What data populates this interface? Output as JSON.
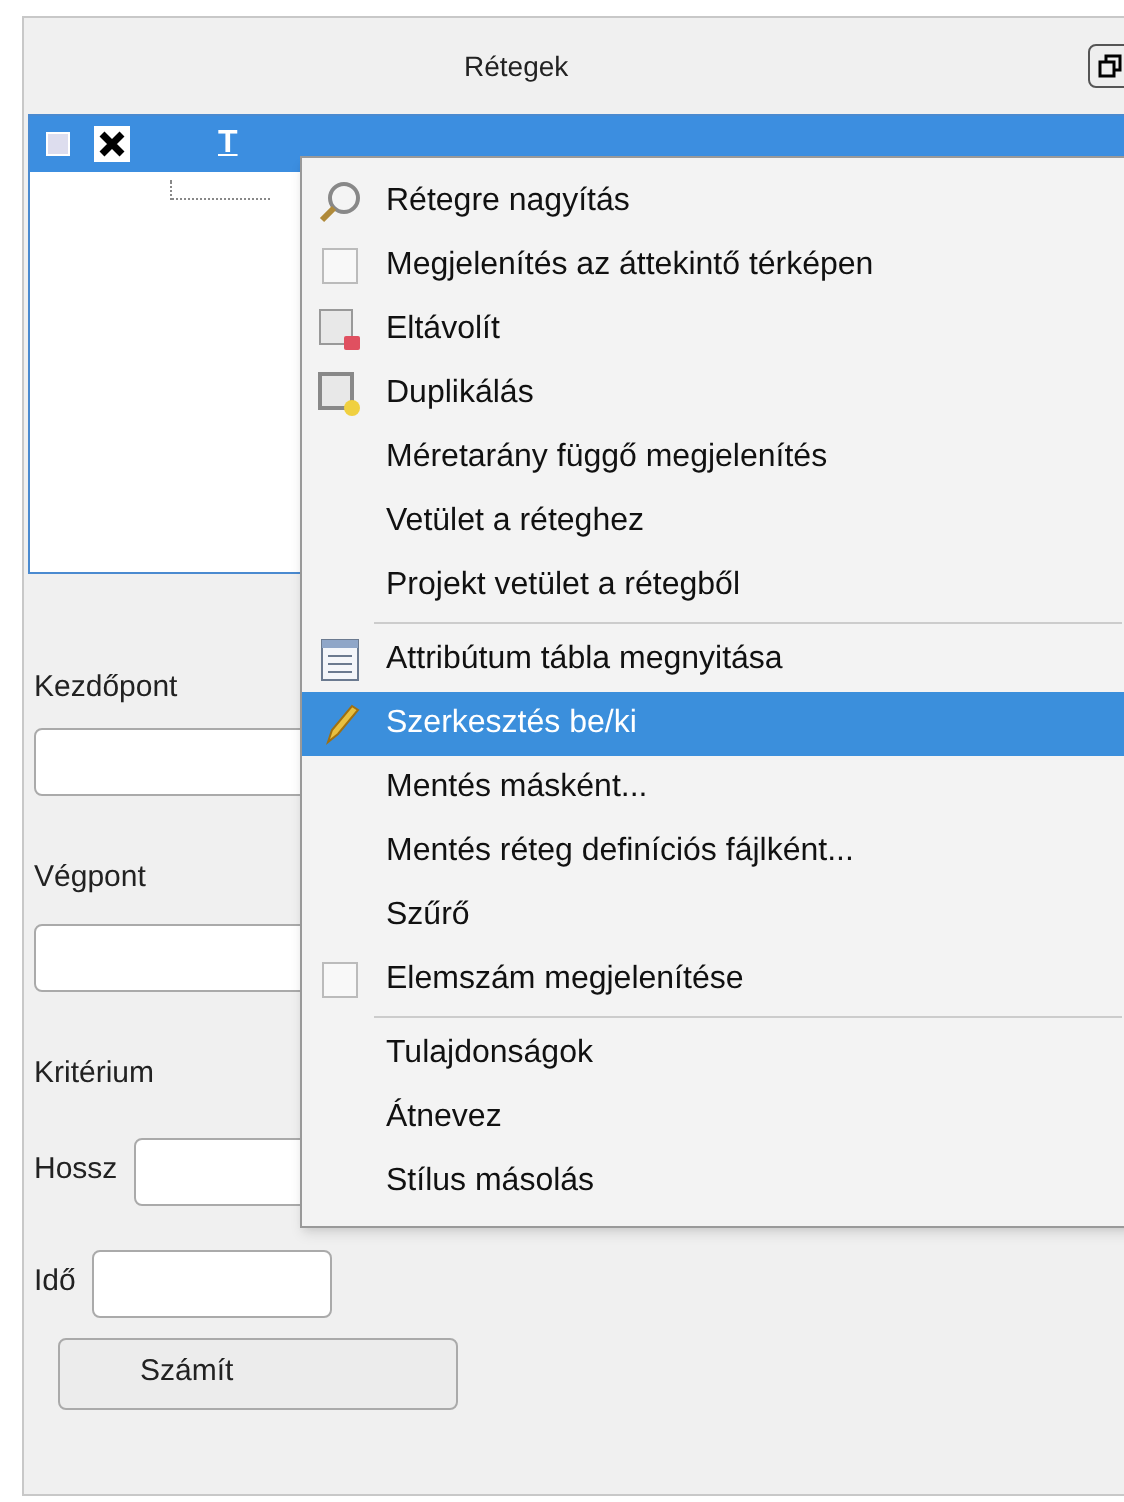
{
  "panel": {
    "title": "Rétegek"
  },
  "layers": [
    {
      "name": "T",
      "selected": true,
      "visible": true
    }
  ],
  "form": {
    "start_label": "Kezdőpont",
    "end_label": "Végpont",
    "criterion_label": "Kritérium",
    "length_label": "Hossz",
    "time_label": "Idő",
    "button": "Számít"
  },
  "context_menu": [
    {
      "kind": "zoom",
      "label": "Rétegre nagyítás",
      "selected": false
    },
    {
      "kind": "checkbox",
      "label": "Megjelenítés az áttekintő térképen",
      "checked": false,
      "selected": false
    },
    {
      "kind": "remove",
      "label": "Eltávolít",
      "selected": false
    },
    {
      "kind": "duplicate",
      "label": "Duplikálás",
      "selected": false
    },
    {
      "kind": "plain",
      "label": "Méretarány függő megjelenítés",
      "selected": false
    },
    {
      "kind": "plain",
      "label": "Vetület a réteghez",
      "selected": false
    },
    {
      "kind": "plain",
      "label": "Projekt vetület a rétegből",
      "selected": false
    },
    {
      "kind": "separator"
    },
    {
      "kind": "table",
      "label": "Attribútum tábla megnyitása",
      "selected": false
    },
    {
      "kind": "pencil",
      "label": "Szerkesztés be/ki",
      "selected": true
    },
    {
      "kind": "plain",
      "label": "Mentés másként...",
      "selected": false
    },
    {
      "kind": "plain",
      "label": "Mentés réteg definíciós fájlként...",
      "selected": false
    },
    {
      "kind": "plain",
      "label": "Szűrő",
      "selected": false
    },
    {
      "kind": "checkbox",
      "label": "Elemszám megjelenítése",
      "checked": false,
      "selected": false
    },
    {
      "kind": "separator"
    },
    {
      "kind": "plain",
      "label": "Tulajdonságok",
      "selected": false
    },
    {
      "kind": "plain",
      "label": "Átnevez",
      "selected": false
    },
    {
      "kind": "plain",
      "label": "Stílus másolás",
      "selected": false
    }
  ]
}
